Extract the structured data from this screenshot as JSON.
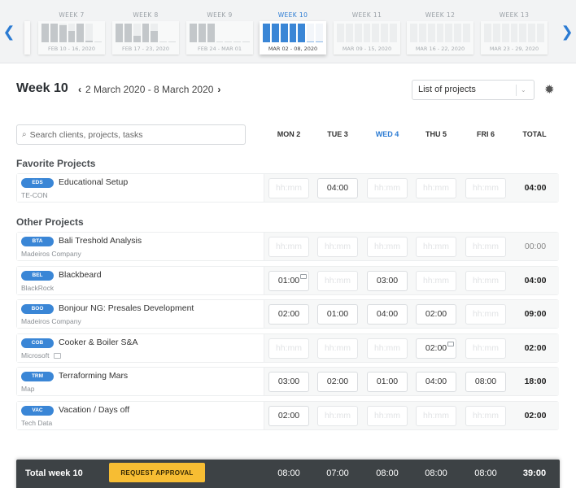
{
  "week_strip": {
    "prev_icon": "chevron-left-icon",
    "next_icon": "chevron-right-icon",
    "weeks": [
      {
        "label": "WEEK 7",
        "range": "FEB 10 - 16, 2020",
        "active": false,
        "fills": [
          1,
          1,
          0.9,
          0.6,
          1,
          0.1,
          0
        ]
      },
      {
        "label": "WEEK 8",
        "range": "FEB 17 - 23, 2020",
        "active": false,
        "fills": [
          1,
          1,
          0.35,
          1,
          0.6,
          0,
          0
        ]
      },
      {
        "label": "WEEK 9",
        "range": "FEB 24 - MAR 01",
        "active": false,
        "fills": [
          1,
          1,
          1,
          0,
          0,
          0,
          0
        ]
      },
      {
        "label": "WEEK 10",
        "range": "MAR 02 - 08, 2020",
        "active": true,
        "fills": [
          1,
          1,
          1,
          1,
          1,
          -1,
          -1
        ]
      },
      {
        "label": "WEEK 11",
        "range": "MAR 09 - 15, 2020",
        "active": false,
        "fills": [
          0,
          0,
          0,
          0,
          0,
          0,
          0
        ]
      },
      {
        "label": "WEEK 12",
        "range": "MAR 16 - 22, 2020",
        "active": false,
        "fills": [
          0,
          0,
          0,
          0,
          0,
          0,
          0
        ]
      },
      {
        "label": "WEEK 13",
        "range": "MAR 23 - 29, 2020",
        "active": false,
        "fills": [
          0,
          0,
          0,
          0,
          0,
          0,
          0
        ]
      }
    ]
  },
  "header": {
    "title": "Week 10",
    "date_range": "2 March 2020 - 8 March 2020",
    "prev_chevron": "‹",
    "next_chevron": "›",
    "view_select": {
      "value": "List of projects",
      "caret": "⌄"
    },
    "settings_icon": "✹"
  },
  "search": {
    "placeholder": "Search clients, projects, tasks",
    "icon": "⌕"
  },
  "columns": {
    "days": [
      {
        "label": "MON 2",
        "today": false
      },
      {
        "label": "TUE 3",
        "today": false
      },
      {
        "label": "WED 4",
        "today": true
      },
      {
        "label": "THU 5",
        "today": false
      },
      {
        "label": "FRI 6",
        "today": false
      }
    ],
    "total_label": "TOTAL"
  },
  "placeholder_time": "hh:mm",
  "sections": {
    "favorites": {
      "title": "Favorite Projects",
      "projects": [
        {
          "code": "EDS",
          "name": "Educational Setup",
          "client": "TE-CON",
          "client_comment": false,
          "entries": [
            {
              "v": ""
            },
            {
              "v": "04:00"
            },
            {
              "v": ""
            },
            {
              "v": ""
            },
            {
              "v": ""
            }
          ],
          "total": "04:00"
        }
      ]
    },
    "others": {
      "title": "Other Projects",
      "projects": [
        {
          "code": "BTA",
          "name": "Bali Treshold Analysis",
          "client": "Madeiros Company",
          "client_comment": false,
          "entries": [
            {
              "v": ""
            },
            {
              "v": ""
            },
            {
              "v": ""
            },
            {
              "v": ""
            },
            {
              "v": ""
            }
          ],
          "total": "00:00"
        },
        {
          "code": "BEL",
          "name": "Blackbeard",
          "client": "BlackRock",
          "client_comment": false,
          "entries": [
            {
              "v": "01:00",
              "note": true
            },
            {
              "v": ""
            },
            {
              "v": "03:00"
            },
            {
              "v": ""
            },
            {
              "v": ""
            }
          ],
          "total": "04:00"
        },
        {
          "code": "BOO",
          "name": "Bonjour NG: Presales Development",
          "client": "Madeiros Company",
          "client_comment": false,
          "entries": [
            {
              "v": "02:00"
            },
            {
              "v": "01:00"
            },
            {
              "v": "04:00"
            },
            {
              "v": "02:00"
            },
            {
              "v": ""
            }
          ],
          "total": "09:00"
        },
        {
          "code": "COB",
          "name": "Cooker & Boiler S&A",
          "client": "Microsoft",
          "client_comment": true,
          "entries": [
            {
              "v": ""
            },
            {
              "v": ""
            },
            {
              "v": ""
            },
            {
              "v": "02:00",
              "note": true
            },
            {
              "v": ""
            }
          ],
          "total": "02:00"
        },
        {
          "code": "TRM",
          "name": "Terraforming Mars",
          "client": "Map",
          "client_comment": false,
          "entries": [
            {
              "v": "03:00"
            },
            {
              "v": "02:00"
            },
            {
              "v": "01:00"
            },
            {
              "v": "04:00"
            },
            {
              "v": "08:00"
            }
          ],
          "total": "18:00"
        },
        {
          "code": "VAC",
          "name": "Vacation / Days off",
          "client": "Tech Data",
          "client_comment": false,
          "entries": [
            {
              "v": "02:00"
            },
            {
              "v": ""
            },
            {
              "v": ""
            },
            {
              "v": ""
            },
            {
              "v": ""
            }
          ],
          "total": "02:00"
        }
      ]
    }
  },
  "footer": {
    "label": "Total week 10",
    "approve_button": "REQUEST APPROVAL",
    "day_totals": [
      "08:00",
      "07:00",
      "08:00",
      "08:00",
      "08:00"
    ],
    "week_total": "39:00"
  },
  "colors": {
    "accent": "#2b7bd3",
    "badge": "#3a86d6",
    "approve": "#f7bd33",
    "footer_bg": "#3d4245"
  }
}
